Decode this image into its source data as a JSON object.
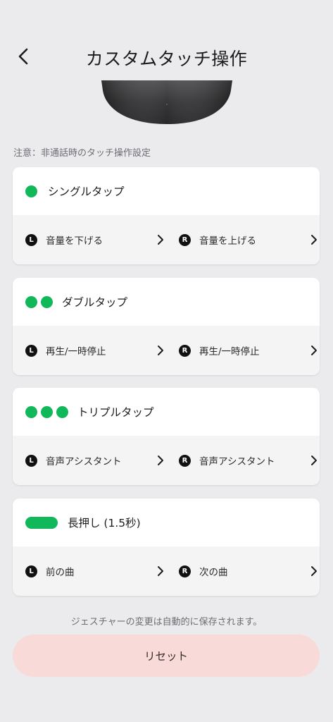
{
  "header": {
    "title": "カスタムタッチ操作"
  },
  "note": "注意：非通話時のタッチ操作設定",
  "gestures": [
    {
      "name": "シングルタップ",
      "left": {
        "badge": "L",
        "action": "音量を下げる"
      },
      "right": {
        "badge": "R",
        "action": "音量を上げる"
      }
    },
    {
      "name": "ダブルタップ",
      "left": {
        "badge": "L",
        "action": "再生/一時停止"
      },
      "right": {
        "badge": "R",
        "action": "再生/一時停止"
      }
    },
    {
      "name": "トリプルタップ",
      "left": {
        "badge": "L",
        "action": "音声アシスタント"
      },
      "right": {
        "badge": "R",
        "action": "音声アシスタント"
      }
    },
    {
      "name": "長押し (1.5秒)",
      "left": {
        "badge": "L",
        "action": "前の曲"
      },
      "right": {
        "badge": "R",
        "action": "次の曲"
      }
    }
  ],
  "save_note": "ジェスチャーの変更は自動的に保存されます。",
  "reset_label": "リセット",
  "colors": {
    "accent_green": "#11b85a",
    "background": "#ebebee",
    "reset_bg": "#f8dad8"
  },
  "icons": {
    "back": "chevron-left-icon",
    "item_arrow": "chevron-right-icon"
  }
}
